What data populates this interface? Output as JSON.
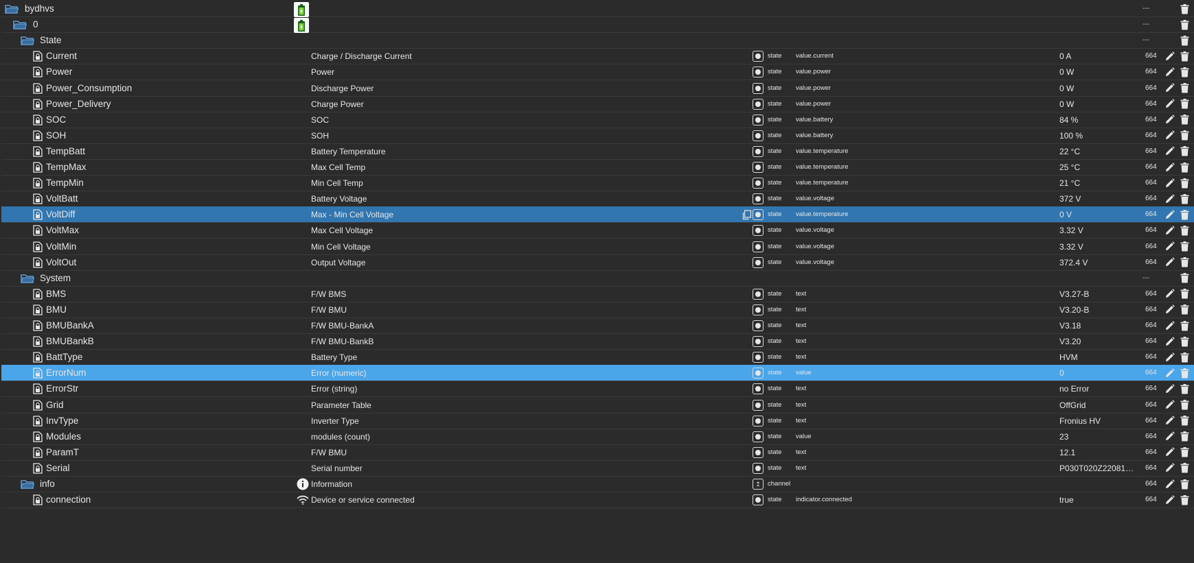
{
  "tree": [
    {
      "kind": "folder",
      "level": 0,
      "name": "bydhvs",
      "adapter_icon": "battery-adapter-icon",
      "acl": "---"
    },
    {
      "kind": "folder",
      "level": 1,
      "name": "0",
      "adapter_icon": "battery-adapter-icon",
      "acl": "---"
    },
    {
      "kind": "folder",
      "level": 2,
      "name": "State",
      "acl": "---"
    },
    {
      "kind": "state",
      "name": "Current",
      "desc": "Charge / Discharge Current",
      "type": "state",
      "role": "value.current",
      "value": "0 A",
      "acl": "664"
    },
    {
      "kind": "state",
      "name": "Power",
      "desc": "Power",
      "type": "state",
      "role": "value.power",
      "value": "0 W",
      "acl": "664"
    },
    {
      "kind": "state",
      "name": "Power_Consumption",
      "desc": "Discharge Power",
      "type": "state",
      "role": "value.power",
      "value": "0 W",
      "acl": "664"
    },
    {
      "kind": "state",
      "name": "Power_Delivery",
      "desc": "Charge Power",
      "type": "state",
      "role": "value.power",
      "value": "0 W",
      "acl": "664"
    },
    {
      "kind": "state",
      "name": "SOC",
      "desc": "SOC",
      "type": "state",
      "role": "value.battery",
      "value": "84 %",
      "acl": "664"
    },
    {
      "kind": "state",
      "name": "SOH",
      "desc": "SOH",
      "type": "state",
      "role": "value.battery",
      "value": "100 %",
      "acl": "664"
    },
    {
      "kind": "state",
      "name": "TempBatt",
      "desc": "Battery Temperature",
      "type": "state",
      "role": "value.temperature",
      "value": "22 °C",
      "acl": "664"
    },
    {
      "kind": "state",
      "name": "TempMax",
      "desc": "Max Cell Temp",
      "type": "state",
      "role": "value.temperature",
      "value": "25 °C",
      "acl": "664"
    },
    {
      "kind": "state",
      "name": "TempMin",
      "desc": "Min Cell Temp",
      "type": "state",
      "role": "value.temperature",
      "value": "21 °C",
      "acl": "664"
    },
    {
      "kind": "state",
      "name": "VoltBatt",
      "desc": "Battery Voltage",
      "type": "state",
      "role": "value.voltage",
      "value": "372 V",
      "acl": "664"
    },
    {
      "kind": "state",
      "name": "VoltDiff",
      "desc": "Max - Min Cell Voltage",
      "type": "state",
      "role": "value.temperature",
      "value": "0 V",
      "acl": "664",
      "selected": "dark",
      "copy": true
    },
    {
      "kind": "state",
      "name": "VoltMax",
      "desc": "Max Cell Voltage",
      "type": "state",
      "role": "value.voltage",
      "value": "3.32 V",
      "acl": "664"
    },
    {
      "kind": "state",
      "name": "VoltMin",
      "desc": "Min Cell Voltage",
      "type": "state",
      "role": "value.voltage",
      "value": "3.32 V",
      "acl": "664"
    },
    {
      "kind": "state",
      "name": "VoltOut",
      "desc": "Output Voltage",
      "type": "state",
      "role": "value.voltage",
      "value": "372.4 V",
      "acl": "664"
    },
    {
      "kind": "folder",
      "level": 2,
      "name": "System",
      "acl": "---"
    },
    {
      "kind": "state",
      "name": "BMS",
      "desc": "F/W BMS",
      "type": "state",
      "role": "text",
      "value": "V3.27-B",
      "acl": "664"
    },
    {
      "kind": "state",
      "name": "BMU",
      "desc": "F/W BMU",
      "type": "state",
      "role": "text",
      "value": "V3.20-B",
      "acl": "664"
    },
    {
      "kind": "state",
      "name": "BMUBankA",
      "desc": "F/W BMU-BankA",
      "type": "state",
      "role": "text",
      "value": "V3.18",
      "acl": "664"
    },
    {
      "kind": "state",
      "name": "BMUBankB",
      "desc": "F/W BMU-BankB",
      "type": "state",
      "role": "text",
      "value": "V3.20",
      "acl": "664"
    },
    {
      "kind": "state",
      "name": "BattType",
      "desc": "Battery Type",
      "type": "state",
      "role": "text",
      "value": "HVM",
      "acl": "664"
    },
    {
      "kind": "state",
      "name": "ErrorNum",
      "desc": "Error (numeric)",
      "type": "state",
      "role": "value",
      "value": "0",
      "acl": "664",
      "selected": "light"
    },
    {
      "kind": "state",
      "name": "ErrorStr",
      "desc": "Error (string)",
      "type": "state",
      "role": "text",
      "value": "no Error",
      "acl": "664"
    },
    {
      "kind": "state",
      "name": "Grid",
      "desc": "Parameter Table",
      "type": "state",
      "role": "text",
      "value": "OffGrid",
      "acl": "664"
    },
    {
      "kind": "state",
      "name": "InvType",
      "desc": "Inverter Type",
      "type": "state",
      "role": "text",
      "value": "Fronius HV",
      "acl": "664"
    },
    {
      "kind": "state",
      "name": "Modules",
      "desc": "modules (count)",
      "type": "state",
      "role": "value",
      "value": "23",
      "acl": "664"
    },
    {
      "kind": "state",
      "name": "ParamT",
      "desc": "F/W BMU",
      "type": "state",
      "role": "text",
      "value": "12.1",
      "acl": "664"
    },
    {
      "kind": "state",
      "name": "Serial",
      "desc": "Serial number",
      "type": "state",
      "role": "text",
      "value": "P030T020Z22081…",
      "acl": "664"
    },
    {
      "kind": "channel",
      "level": 2,
      "name": "info",
      "desc": "Information",
      "type": "channel",
      "role_icon": "info-icon",
      "acl": "664"
    },
    {
      "kind": "state",
      "name": "connection",
      "desc": "Device or service connected",
      "type": "state",
      "role": "indicator.connected",
      "value": "true",
      "acl": "664",
      "role_icon": "wifi-icon"
    }
  ]
}
